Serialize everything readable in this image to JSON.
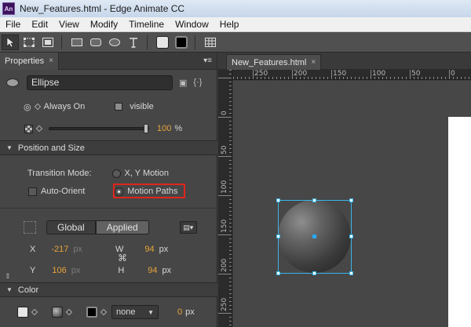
{
  "window": {
    "logo": "An",
    "title": "New_Features.html - Edge Animate CC"
  },
  "menu": [
    "File",
    "Edit",
    "View",
    "Modify",
    "Timeline",
    "Window",
    "Help"
  ],
  "toolbar": {
    "fill_color": "#e6e6e6",
    "stroke_color": "#000000"
  },
  "properties_panel": {
    "tab_label": "Properties",
    "tab_close": "×",
    "panel_menu": "▾≡",
    "element_name": "Ellipse",
    "display_value": "Always On",
    "overflow_value": "visible",
    "opacity_value": "100",
    "opacity_unit": "%",
    "opacity_level_percent": 100
  },
  "position_size": {
    "section_title": "Position and Size",
    "transition_mode_label": "Transition Mode:",
    "option_xy": "X, Y Motion",
    "option_paths": "Motion Paths",
    "auto_orient_label": "Auto-Orient",
    "selected_mode": "Motion Paths",
    "coord_global": "Global",
    "coord_applied": "Applied",
    "x_label": "X",
    "x_value": "-217",
    "y_label": "Y",
    "y_value": "106",
    "w_label": "W",
    "w_value": "94",
    "h_label": "H",
    "h_value": "94",
    "px": "px"
  },
  "color_section": {
    "section_title": "Color",
    "border_style": "none",
    "border_width_value": "0",
    "border_width_unit": "px"
  },
  "stage": {
    "tab_label": "New_Features.html",
    "tab_close": "×",
    "ruler_top_labels": [
      "250",
      "200",
      "150",
      "100",
      "50",
      "0",
      "50"
    ],
    "ruler_left_labels": [
      "0",
      "50",
      "100",
      "150",
      "200",
      "250"
    ]
  },
  "colors": {
    "selection": "#3bb6e8",
    "highlight": "#e1251b",
    "accent_value": "#e8a33a"
  }
}
